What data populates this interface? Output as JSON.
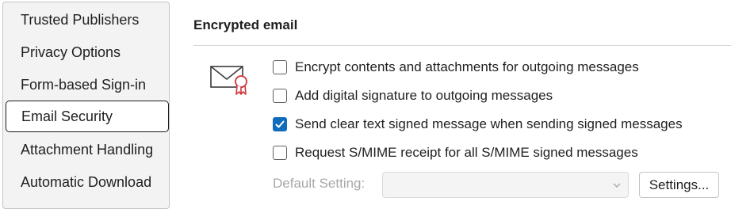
{
  "sidebar": {
    "items": [
      {
        "label": "Trusted Publishers"
      },
      {
        "label": "Privacy Options"
      },
      {
        "label": "Form-based Sign-in"
      },
      {
        "label": "Email Security",
        "selected": true
      },
      {
        "label": "Attachment Handling"
      },
      {
        "label": "Automatic Download"
      }
    ]
  },
  "encrypted_email": {
    "title": "Encrypted email",
    "icon": "envelope-certificate-icon",
    "options": [
      {
        "label": "Encrypt contents and attachments for outgoing messages",
        "checked": false
      },
      {
        "label": "Add digital signature to outgoing messages",
        "checked": false
      },
      {
        "label": "Send clear text signed message when sending signed messages",
        "checked": true
      },
      {
        "label": "Request S/MIME receipt for all S/MIME signed messages",
        "checked": false
      }
    ],
    "default_setting_label": "Default Setting:",
    "default_setting_value": "",
    "settings_button": "Settings..."
  },
  "colors": {
    "accent": "#0f6cbd",
    "sidebar_bg": "#f3f3f3",
    "disabled_text": "#a8a8a8",
    "certificate_ribbon": "#d13438"
  }
}
